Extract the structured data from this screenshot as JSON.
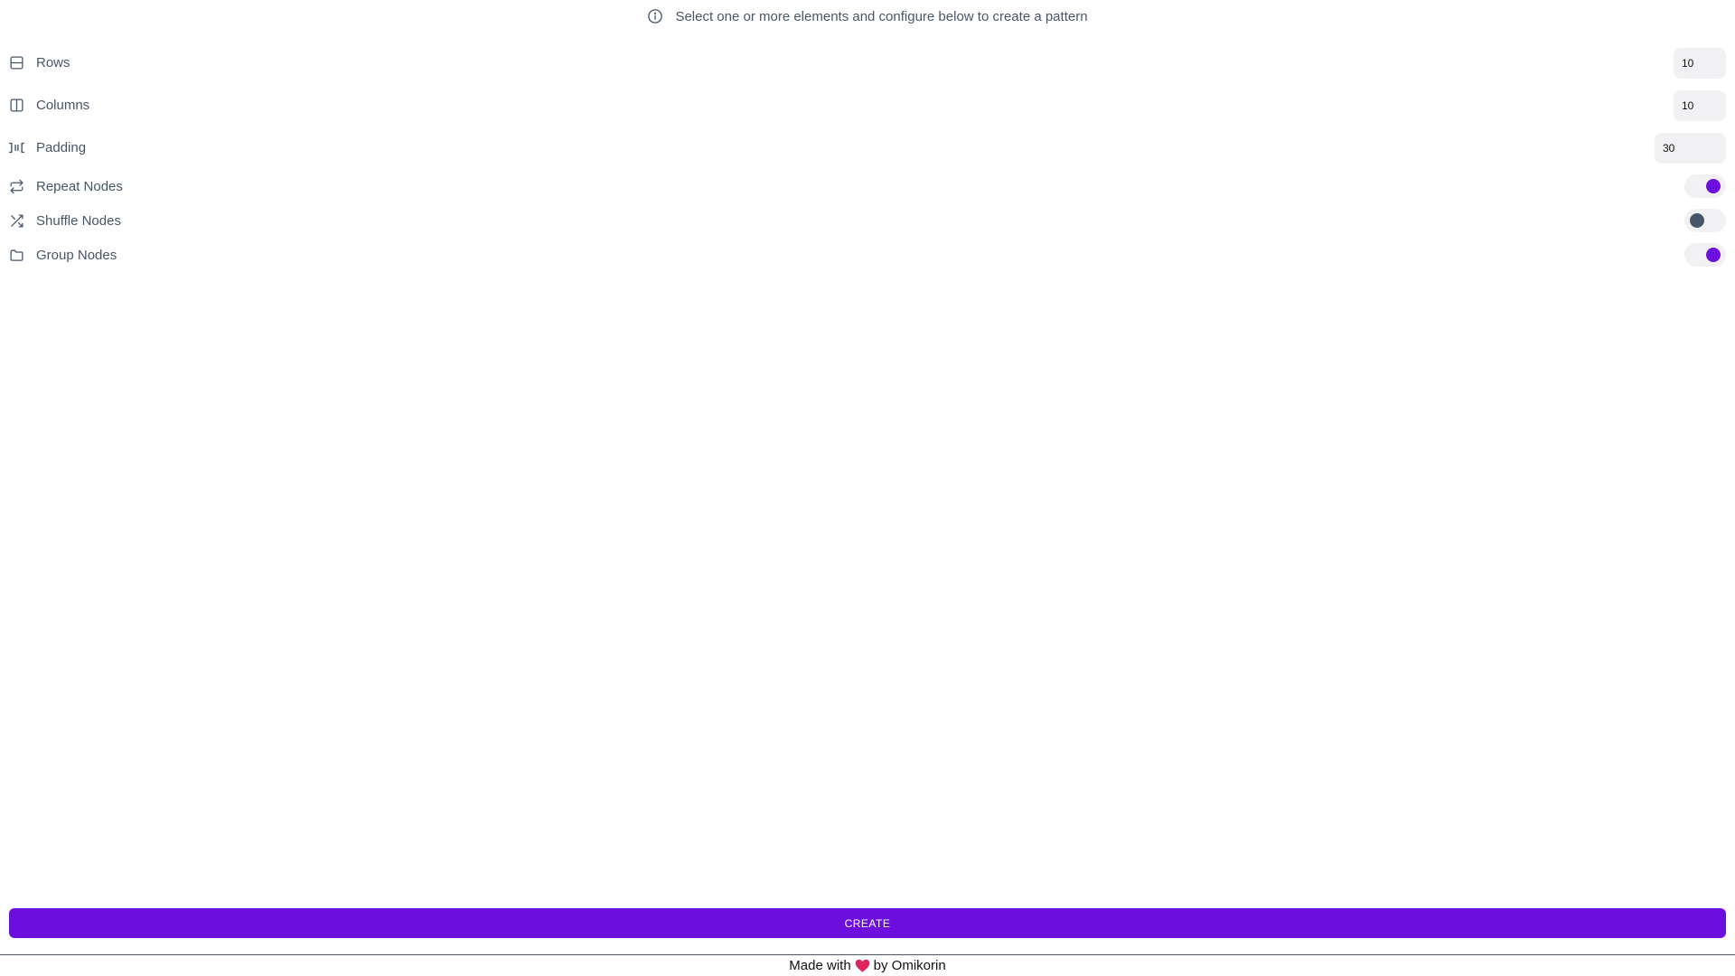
{
  "banner": {
    "text": "Select one or more elements and configure below to create a pattern",
    "icon": "info-icon"
  },
  "options": {
    "rows": {
      "label": "Rows",
      "value": "10",
      "icon": "rows-icon"
    },
    "columns": {
      "label": "Columns",
      "value": "10",
      "icon": "columns-icon"
    },
    "padding": {
      "label": "Padding",
      "value": "30",
      "icon": "padding-icon"
    },
    "repeat_nodes": {
      "label": "Repeat Nodes",
      "enabled": true,
      "icon": "repeat-icon"
    },
    "shuffle_nodes": {
      "label": "Shuffle Nodes",
      "enabled": false,
      "icon": "shuffle-icon"
    },
    "group_nodes": {
      "label": "Group Nodes",
      "enabled": true,
      "icon": "folder-icon"
    }
  },
  "actions": {
    "create_label": "CREATE"
  },
  "footer": {
    "prefix": "Made with",
    "suffix": "by Omikorin",
    "icon": "heart-icon"
  },
  "colors": {
    "accent": "#6d0fdc",
    "text": "#475569",
    "input_bg": "#f1f1f3",
    "heart": "#e0245e"
  }
}
